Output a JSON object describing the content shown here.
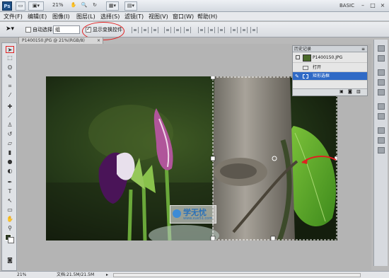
{
  "app": {
    "logo": "Ps",
    "zoom_display": "21%",
    "workspace": "BASIC",
    "window_controls": [
      "–",
      "□",
      "×"
    ],
    "toolbar_buttons": [
      "folder-icon",
      "screen-mode-icon",
      "hand-icon",
      "zoom-icon",
      "rotate-icon",
      "arrange-icon",
      "extras-icon"
    ]
  },
  "menu": [
    "文件(F)",
    "编辑(E)",
    "图像(I)",
    "图层(L)",
    "选择(S)",
    "滤镜(T)",
    "视图(V)",
    "窗口(W)",
    "帮助(H)"
  ],
  "options": {
    "auto_select_label": "自动选择:",
    "auto_select_value": "组",
    "show_transform_label": "显示变换控件"
  },
  "document": {
    "tab_title": "P1400150.JPG @ 21%(RGB/8)"
  },
  "watermark": {
    "name": "学无忧",
    "url": "www.xue51.com"
  },
  "history": {
    "panel_title": "历史记录",
    "snapshot": "P1400150.JPG",
    "items": [
      {
        "label": "打开",
        "selected": false
      },
      {
        "label": "矩形选框",
        "selected": true
      }
    ]
  },
  "status": {
    "zoom": "21%",
    "doc_info": "文档:21.5M/21.5M"
  },
  "colors": {
    "highlight": "#e02020",
    "selection": "#2f6ac6",
    "foreground": "#2d3a23",
    "background": "#ffffff"
  }
}
